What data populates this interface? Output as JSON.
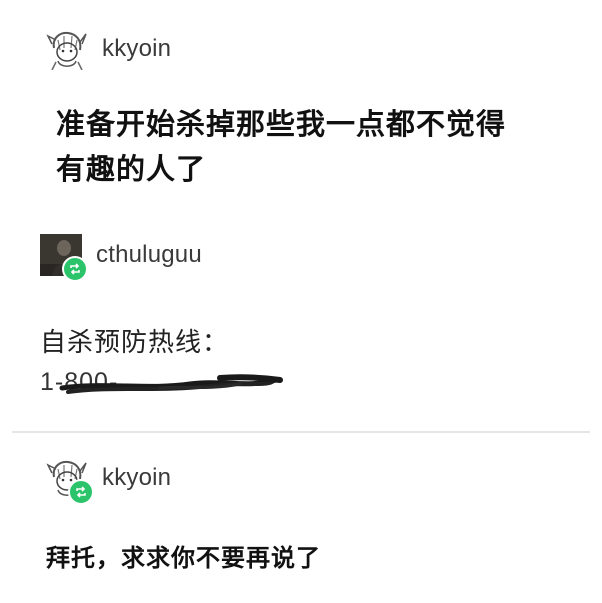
{
  "posts": [
    {
      "username": "kkyoin",
      "avatar": "sketch-character-avatar",
      "text_line1": "准备开始杀掉那些我一点都不觉得",
      "text_line2": "有趣的人了"
    },
    {
      "username": "cthuluguu",
      "avatar": "dark-photo-avatar",
      "reblog_icon": "reblog-icon",
      "text": "自杀预防热线：",
      "phone_number_visible": "1-800-",
      "phone_number_redacted": true
    },
    {
      "username": "kkyoin",
      "avatar": "sketch-character-avatar",
      "reblog_icon": "reblog-icon",
      "text": "拜托，求求你不要再说了"
    }
  ],
  "colors": {
    "background": "#ffffff",
    "reblog_badge": "#2bc46b",
    "divider": "#e6e6e6",
    "redaction": "#1a1a1a"
  }
}
